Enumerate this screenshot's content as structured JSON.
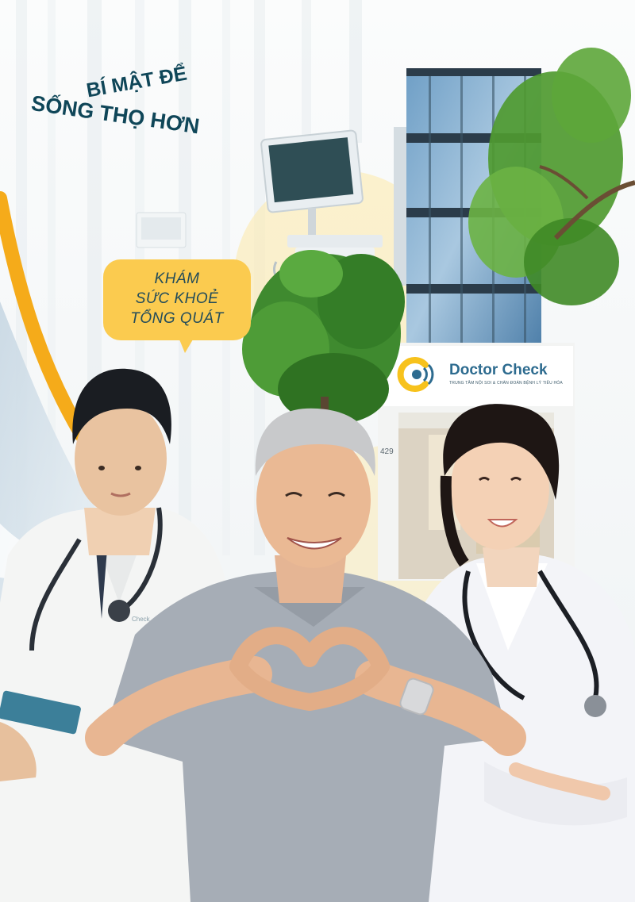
{
  "headline": {
    "line1": "BÍ MẬT ĐỂ",
    "line2": "SỐNG THỌ HƠN"
  },
  "bubble": {
    "lines": [
      "KHÁM",
      "SỨC KHOẺ",
      "TỔNG QUÁT"
    ]
  },
  "clinic_sign": {
    "name": "Doctor Check",
    "subtitle": "TRUNG TÂM NỘI SOI & CHẨN ĐOÁN BỆNH LÝ TIÊU HÓA",
    "logo_icon": "doctor-check-logo-icon"
  },
  "building": {
    "house_number": "429"
  },
  "coat_brand": "Check",
  "colors": {
    "brand_navy": "#0f4658",
    "accent_yellow": "#fbcb4f",
    "accent_orange": "#f5ab1a",
    "sign_blue": "#2d6b8f"
  }
}
